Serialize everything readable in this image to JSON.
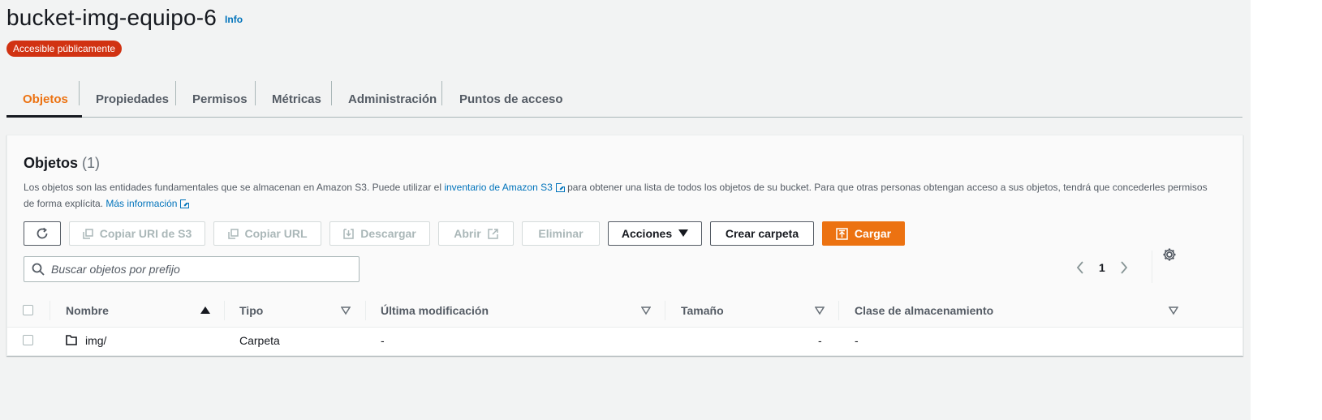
{
  "header": {
    "title": "bucket-img-equipo-6",
    "info_link": "Info",
    "badge": "Accesible públicamente"
  },
  "tabs": [
    {
      "label": "Objetos",
      "active": true
    },
    {
      "label": "Propiedades"
    },
    {
      "label": "Permisos"
    },
    {
      "label": "Métricas"
    },
    {
      "label": "Administración"
    },
    {
      "label": "Puntos de acceso"
    }
  ],
  "objects_panel": {
    "title": "Objetos",
    "count": "(1)",
    "description": {
      "part1": "Los objetos son las entidades fundamentales que se almacenan en Amazon S3. Puede utilizar el ",
      "link1": "inventario de Amazon S3",
      "part2": " para obtener una lista de todos los objetos de su bucket. Para que otras personas obtengan acceso a sus objetos, tendrá que concederles permisos de forma explícita. ",
      "link2": "Más información"
    },
    "toolbar": {
      "copy_uri": "Copiar URI de S3",
      "copy_url": "Copiar URL",
      "download": "Descargar",
      "open": "Abrir",
      "delete": "Eliminar",
      "actions": "Acciones",
      "create_folder": "Crear carpeta",
      "upload": "Cargar"
    },
    "search": {
      "placeholder": "Buscar objetos por prefijo",
      "value": ""
    },
    "pagination": {
      "current_page": "1"
    },
    "table": {
      "columns": [
        "Nombre",
        "Tipo",
        "Última modificación",
        "Tamaño",
        "Clase de almacenamiento"
      ],
      "rows": [
        {
          "name": "img/",
          "type": "Carpeta",
          "last_modified": "-",
          "size": "-",
          "storage_class": "-"
        }
      ]
    }
  },
  "colors": {
    "accent": "#ec7211",
    "link": "#0073bb",
    "badge": "#d13212"
  }
}
